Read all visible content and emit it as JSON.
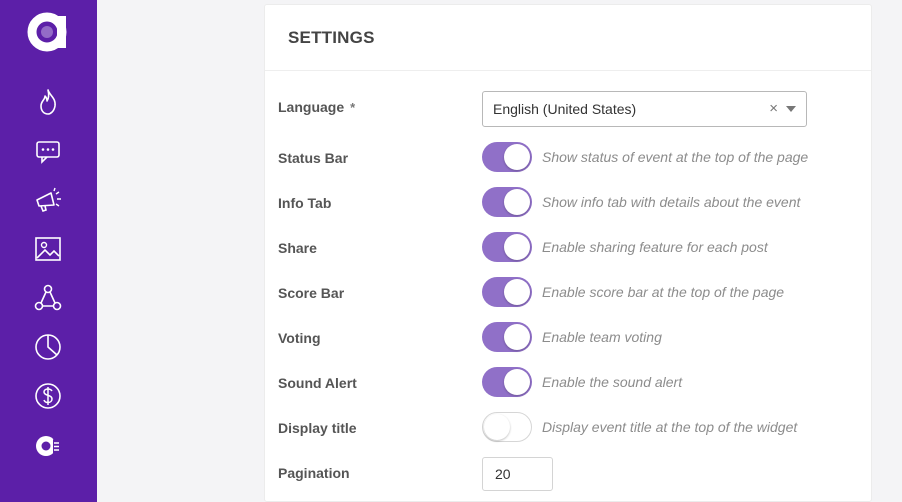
{
  "colors": {
    "sidebar": "#5c1fa8",
    "toggle_on": "#9070c8"
  },
  "sidebar": {
    "icons": [
      "logo-icon",
      "flame-icon",
      "chat-icon",
      "megaphone-icon",
      "image-icon",
      "network-icon",
      "pie-chart-icon",
      "dollar-icon",
      "brand-badge-icon"
    ]
  },
  "settings": {
    "title": "SETTINGS",
    "language": {
      "label": "Language",
      "required_mark": "*",
      "value": "English (United States)",
      "clear": "×"
    },
    "toggles": [
      {
        "label": "Status Bar",
        "on": true,
        "description": "Show status of event at the top of the page"
      },
      {
        "label": "Info Tab",
        "on": true,
        "description": "Show info tab with details about the event"
      },
      {
        "label": "Share",
        "on": true,
        "description": "Enable sharing feature for each post"
      },
      {
        "label": "Score Bar",
        "on": true,
        "description": "Enable score bar at the top of the page"
      },
      {
        "label": "Voting",
        "on": true,
        "description": "Enable team voting"
      },
      {
        "label": "Sound Alert",
        "on": true,
        "description": "Enable the sound alert"
      },
      {
        "label": "Display title",
        "on": false,
        "description": "Display event title at the top of the widget"
      }
    ],
    "pagination": {
      "label": "Pagination",
      "value": "20"
    }
  }
}
